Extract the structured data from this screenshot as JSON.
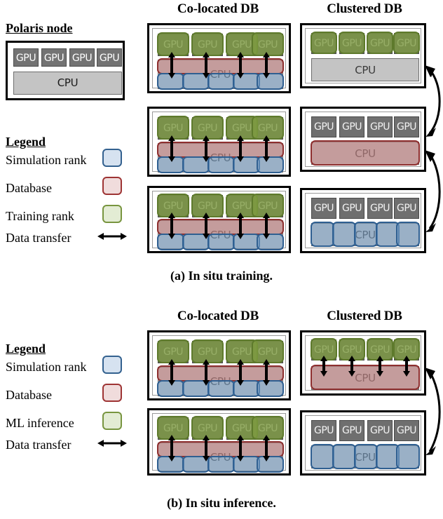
{
  "figure": {
    "panels": [
      {
        "id": "a",
        "caption": "(a) In situ training.",
        "columns": {
          "colocated": "Co-located DB",
          "clustered": "Clustered DB"
        },
        "legend": {
          "title": "Legend",
          "items": [
            {
              "label": "Simulation rank",
              "swatch": "sim-rank-swatch",
              "color": "#d6e2f0",
              "border": "#33618f"
            },
            {
              "label": "Database",
              "swatch": "database-swatch",
              "color": "#f0dcdc",
              "border": "#9e3434"
            },
            {
              "label": "Training rank",
              "swatch": "training-rank-swatch",
              "color": "#e3ecd4",
              "border": "#78953f"
            },
            {
              "label": "Data transfer",
              "swatch": "data-transfer-arrow-icon",
              "color": "#000000",
              "border": "#000000"
            }
          ]
        },
        "polaris": {
          "title": "Polaris node",
          "gpu_label": "GPU",
          "gpu_count": 4,
          "cpu_label": "CPU"
        },
        "colocated_nodes": [
          {
            "gpu_label": "GPU",
            "gpu_count": 4,
            "cpu_label": "CPU",
            "gpu_role": "training-rank",
            "cpu_roles": [
              "database",
              "simulation-rank"
            ],
            "sim_rank_count": 5,
            "arrow_pairs": 4
          },
          {
            "gpu_label": "GPU",
            "gpu_count": 4,
            "cpu_label": "CPU",
            "gpu_role": "training-rank",
            "cpu_roles": [
              "database",
              "simulation-rank"
            ],
            "sim_rank_count": 5,
            "arrow_pairs": 4
          },
          {
            "gpu_label": "GPU",
            "gpu_count": 4,
            "cpu_label": "CPU",
            "gpu_role": "training-rank",
            "cpu_roles": [
              "database",
              "simulation-rank"
            ],
            "sim_rank_count": 5,
            "arrow_pairs": 4
          }
        ],
        "clustered_nodes": [
          {
            "gpu_label": "GPU",
            "gpu_count": 4,
            "cpu_label": "CPU",
            "gpu_role": "training-rank",
            "cpu_role": "none",
            "sim_rank_count": 0,
            "arrow_pairs": 0
          },
          {
            "gpu_label": "GPU",
            "gpu_count": 4,
            "cpu_label": "CPU",
            "gpu_role": "none",
            "cpu_role": "database",
            "sim_rank_count": 0,
            "arrow_pairs": 0
          },
          {
            "gpu_label": "GPU",
            "gpu_count": 4,
            "cpu_label": "CPU",
            "gpu_role": "none",
            "cpu_role": "simulation-rank",
            "sim_rank_count": 5,
            "arrow_pairs": 0
          }
        ],
        "connectors": [
          {
            "from": "clustered-node-2",
            "to": "clustered-node-1",
            "style": "curved-double-arrow"
          },
          {
            "from": "clustered-node-3",
            "to": "clustered-node-2",
            "style": "curved-double-arrow"
          }
        ]
      },
      {
        "id": "b",
        "caption": "(b) In situ inference.",
        "columns": {
          "colocated": "Co-located DB",
          "clustered": "Clustered DB"
        },
        "legend": {
          "title": "Legend",
          "items": [
            {
              "label": "Simulation rank",
              "swatch": "sim-rank-swatch",
              "color": "#d6e2f0",
              "border": "#33618f"
            },
            {
              "label": "Database",
              "swatch": "database-swatch",
              "color": "#f0dcdc",
              "border": "#9e3434"
            },
            {
              "label": "ML inference",
              "swatch": "ml-inference-swatch",
              "color": "#e3ecd4",
              "border": "#78953f"
            },
            {
              "label": "Data transfer",
              "swatch": "data-transfer-arrow-icon",
              "color": "#000000",
              "border": "#000000"
            }
          ]
        },
        "colocated_nodes": [
          {
            "gpu_label": "GPU",
            "gpu_count": 4,
            "cpu_label": "CPU",
            "gpu_role": "ml-inference",
            "cpu_roles": [
              "database",
              "simulation-rank"
            ],
            "sim_rank_count": 5,
            "arrow_pairs": 4
          },
          {
            "gpu_label": "GPU",
            "gpu_count": 4,
            "cpu_label": "CPU",
            "gpu_role": "ml-inference",
            "cpu_roles": [
              "database",
              "simulation-rank"
            ],
            "sim_rank_count": 5,
            "arrow_pairs": 4
          }
        ],
        "clustered_nodes": [
          {
            "gpu_label": "GPU",
            "gpu_count": 4,
            "cpu_label": "CPU",
            "gpu_role": "ml-inference",
            "cpu_role": "database",
            "sim_rank_count": 0,
            "arrow_pairs": 4
          },
          {
            "gpu_label": "GPU",
            "gpu_count": 4,
            "cpu_label": "CPU",
            "gpu_role": "none",
            "cpu_role": "simulation-rank",
            "sim_rank_count": 5,
            "arrow_pairs": 0
          }
        ],
        "connectors": [
          {
            "from": "clustered-node-2",
            "to": "clustered-node-1",
            "style": "curved-double-arrow"
          }
        ]
      }
    ]
  }
}
